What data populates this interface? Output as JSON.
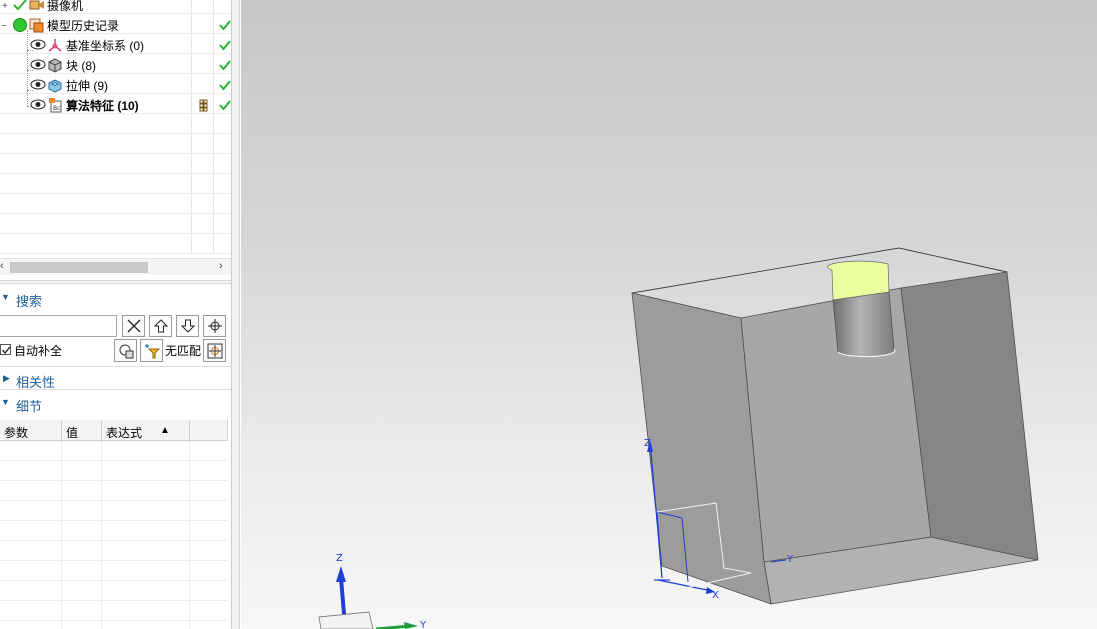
{
  "tree": {
    "nodes": [
      {
        "label": "摄像机",
        "icon": "camera-icon",
        "bold": false
      },
      {
        "label": "模型历史记录",
        "icon": "model-history-icon",
        "bold": false
      },
      {
        "label": "基准坐标系 (0)",
        "icon": "datum-csys-icon",
        "bold": false
      },
      {
        "label": "块 (8)",
        "icon": "block-icon",
        "bold": false
      },
      {
        "label": "拉伸 (9)",
        "icon": "extrude-icon",
        "bold": false
      },
      {
        "label": "算法特征 (10)",
        "icon": "algorithmic-feature-icon",
        "bold": true
      }
    ],
    "status_color": "#2db32d"
  },
  "search": {
    "title": "搜索",
    "input_value": "",
    "autocomplete_label": "自动补全",
    "autocomplete_checked": true,
    "nomatch_label": "无匹配"
  },
  "dependencies": {
    "title": "相关性"
  },
  "details": {
    "title": "细节",
    "columns": [
      "参数",
      "值",
      "表达式"
    ],
    "sort_indicator": "▲"
  },
  "viewport": {
    "triad_labels": {
      "z": "Z",
      "y": "Y",
      "x": "X"
    },
    "face_highlight_color": "#eaffa0",
    "wcs_color": "#1f3fd6"
  }
}
